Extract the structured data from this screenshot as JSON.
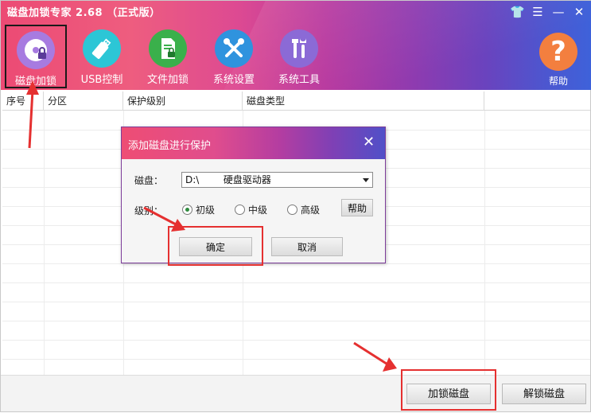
{
  "window": {
    "title": "磁盘加锁专家 2.68 （正式版）"
  },
  "toolbar": {
    "items": [
      {
        "label": "磁盘加锁",
        "icon": "disk-lock-icon"
      },
      {
        "label": "USB控制",
        "icon": "usb-drive-icon"
      },
      {
        "label": "文件加锁",
        "icon": "file-lock-icon"
      },
      {
        "label": "系统设置",
        "icon": "tools-icon"
      },
      {
        "label": "系统工具",
        "icon": "wrench-screwdriver-icon"
      }
    ],
    "help_label": "帮助",
    "help_glyph": "?"
  },
  "window_controls": {
    "shirt": "👕",
    "menu": "☰",
    "minimize": "—",
    "close": "✕"
  },
  "table": {
    "columns": [
      "序号",
      "分区",
      "保护级别",
      "磁盘类型"
    ]
  },
  "footer": {
    "lock_button": "加锁磁盘",
    "unlock_button": "解锁磁盘"
  },
  "dialog": {
    "title": "添加磁盘进行保护",
    "close_glyph": "✕",
    "disk_label": "磁盘：",
    "disk_value": "D:\\        硬盘驱动器",
    "level_label": "级别：",
    "levels": [
      "初级",
      "中级",
      "高级"
    ],
    "selected_level": "初级",
    "help_button": "帮助",
    "ok_button": "确定",
    "cancel_button": "取消"
  },
  "colors": {
    "accent_pink": "#ec4a74",
    "accent_blue": "#3e62da",
    "highlight_red": "#e53030"
  }
}
